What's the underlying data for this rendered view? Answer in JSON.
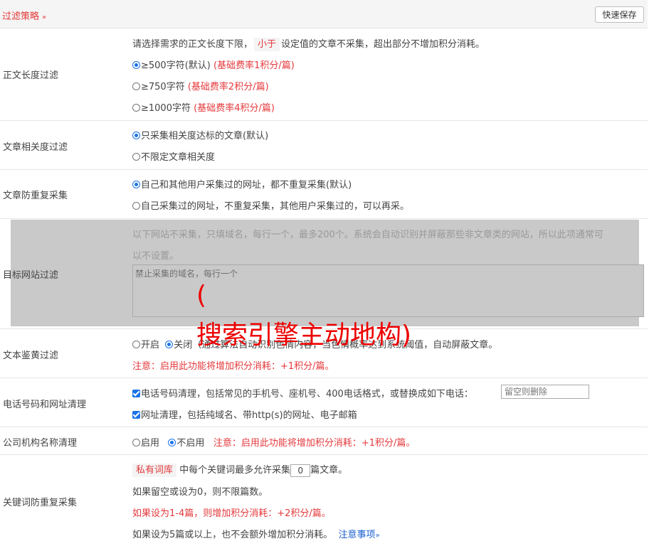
{
  "header": {
    "title": "过滤策略",
    "save_label": "快速保存"
  },
  "length_filter": {
    "label": "正文长度过滤",
    "desc_prefix": "请选择需求的正文长度下限，",
    "desc_tag": "小于",
    "desc_suffix": "设定值的文章不采集，超出部分不增加积分消耗。",
    "options": [
      {
        "text": "≥500字符(默认)",
        "rate": "(基础费率1积分/篇)",
        "selected": true
      },
      {
        "text": "≥750字符",
        "rate": "(基础费率2积分/篇)",
        "selected": false
      },
      {
        "text": "≥1000字符",
        "rate": "(基础费率4积分/篇)",
        "selected": false
      }
    ]
  },
  "relevance_filter": {
    "label": "文章相关度过滤",
    "options": [
      {
        "text": "只采集相关度达标的文章(默认)",
        "selected": true
      },
      {
        "text": "不限定文章相关度",
        "selected": false
      }
    ]
  },
  "dedupe": {
    "label": "文章防重复采集",
    "options": [
      {
        "text": "自己和其他用户采集过的网址，都不重复采集(默认)",
        "selected": true
      },
      {
        "text": "自己采集过的网址，不重复采集，其他用户采集过的，可以再采。",
        "selected": false
      }
    ]
  },
  "site_filter": {
    "label": "目标网站过滤",
    "desc_line1": "以下网站不采集，只填域名，每行一个，最多200个。系统会自动识别并屏蔽那些非文章类的网站，所以此项通常可",
    "desc_line2": "以不设置。",
    "placeholder": "禁止采集的域名，每行一个"
  },
  "watermark": {
    "line1": "(",
    "line2": "搜索引擎主动地构)"
  },
  "porn_filter": {
    "label": "文本鉴黄过滤",
    "on_label": "开启",
    "off_label": "关闭",
    "desc": "（通过算法自动识别色情内容，当色情概率达到系统阈值，自动屏蔽文章。",
    "note": "注意：启用此功能将增加积分消耗：+1积分/篇。"
  },
  "contact_clean": {
    "label": "电话号码和网址清理",
    "phone_text": "电话号码清理，包括常见的手机号、座机号、400电话格式，或替换成如下电话：",
    "phone_placeholder": "留空则删除",
    "url_text": "网址清理，包括纯域名、带http(s)的网址、电子邮箱"
  },
  "company_clean": {
    "label": "公司机构名称清理",
    "on_label": "启用",
    "off_label": "不启用",
    "note": "注意：启用此功能将增加积分消耗：+1积分/篇。"
  },
  "keyword_dedupe": {
    "label": "关键词防重复采集",
    "tag": "私有词库",
    "line1_a": "中每个关键词最多允许采集",
    "count": "0",
    "line1_b": "篇文章。",
    "line2": "如果留空或设为0，则不限篇数。",
    "line3": "如果设为1-4篇，则增加积分消耗：+2积分/篇。",
    "line4": "如果设为5篇或以上，也不会额外增加积分消耗。",
    "notes_link": "注意事项"
  }
}
